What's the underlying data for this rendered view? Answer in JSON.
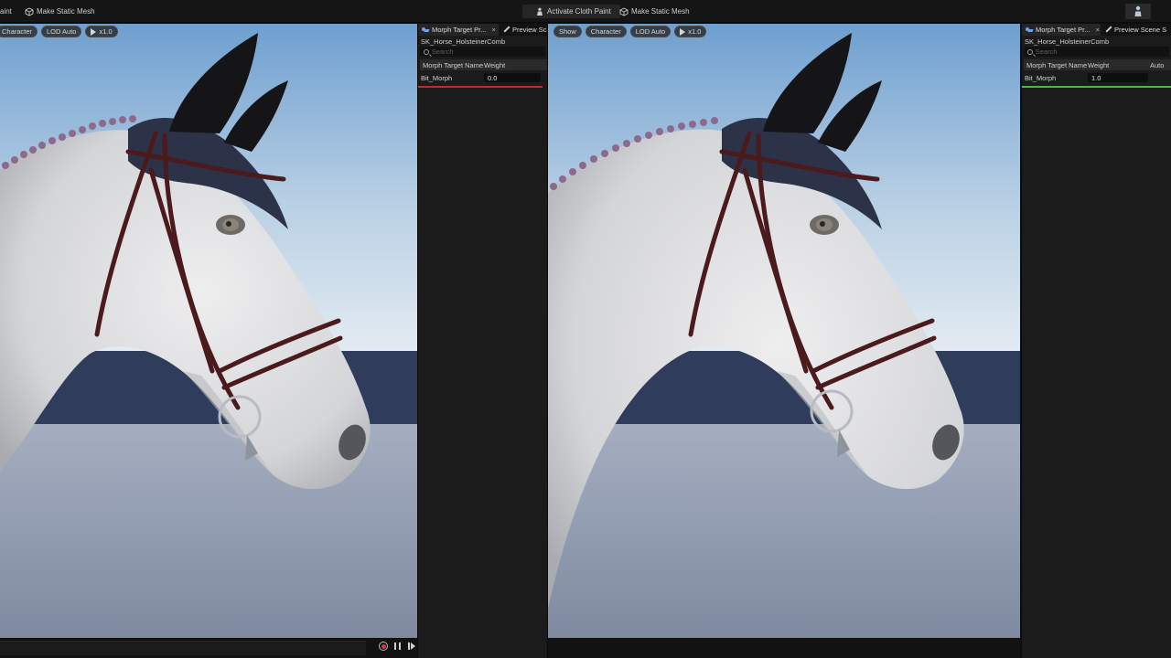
{
  "toolbar": {
    "left_cut_label": "aint",
    "make_static_mesh_left": "Make Static Mesh",
    "activate_cloth_paint": "Activate Cloth Paint",
    "make_static_mesh_right": "Make Static Mesh"
  },
  "viewport_left": {
    "pills": {
      "character": "Character",
      "lod": "LOD Auto",
      "speed": "x1.0"
    }
  },
  "viewport_right": {
    "pills": {
      "show": "Show",
      "character": "Character",
      "lod": "LOD Auto",
      "speed": "x1.0"
    }
  },
  "panel_left": {
    "tab_morph": "Morph Target Pr...",
    "tab_preview": "Preview Sc",
    "mesh_name": "SK_Horse_HolsteinerComb",
    "search_placeholder": "Search",
    "col_name": "Morph Target Name",
    "col_weight": "Weight",
    "row_name": "Bit_Morph",
    "row_weight": "0.0",
    "weight_fraction": 0.0,
    "underline_color": "#c42a2a"
  },
  "panel_right": {
    "tab_morph": "Morph Target Pr...",
    "tab_preview": "Preview Scene S",
    "mesh_name": "SK_Horse_HolsteinerComb",
    "search_placeholder": "Search",
    "col_name": "Morph Target Name",
    "col_weight": "Weight",
    "col_auto": "Auto",
    "row_name": "Bit_Morph",
    "row_weight": "1.0",
    "weight_fraction": 1.0,
    "underline_color": "#3fc23a"
  },
  "colors": {
    "sky_top": "#7aa6d2",
    "sky_bottom": "#d8e4ee",
    "backdrop_blue": "#2d3a5a",
    "floor": "#8a95a8",
    "horse_coat": "#d9dadc",
    "bridle_leather": "#4a1a1c",
    "ear_bonnet": "#2a3044"
  }
}
